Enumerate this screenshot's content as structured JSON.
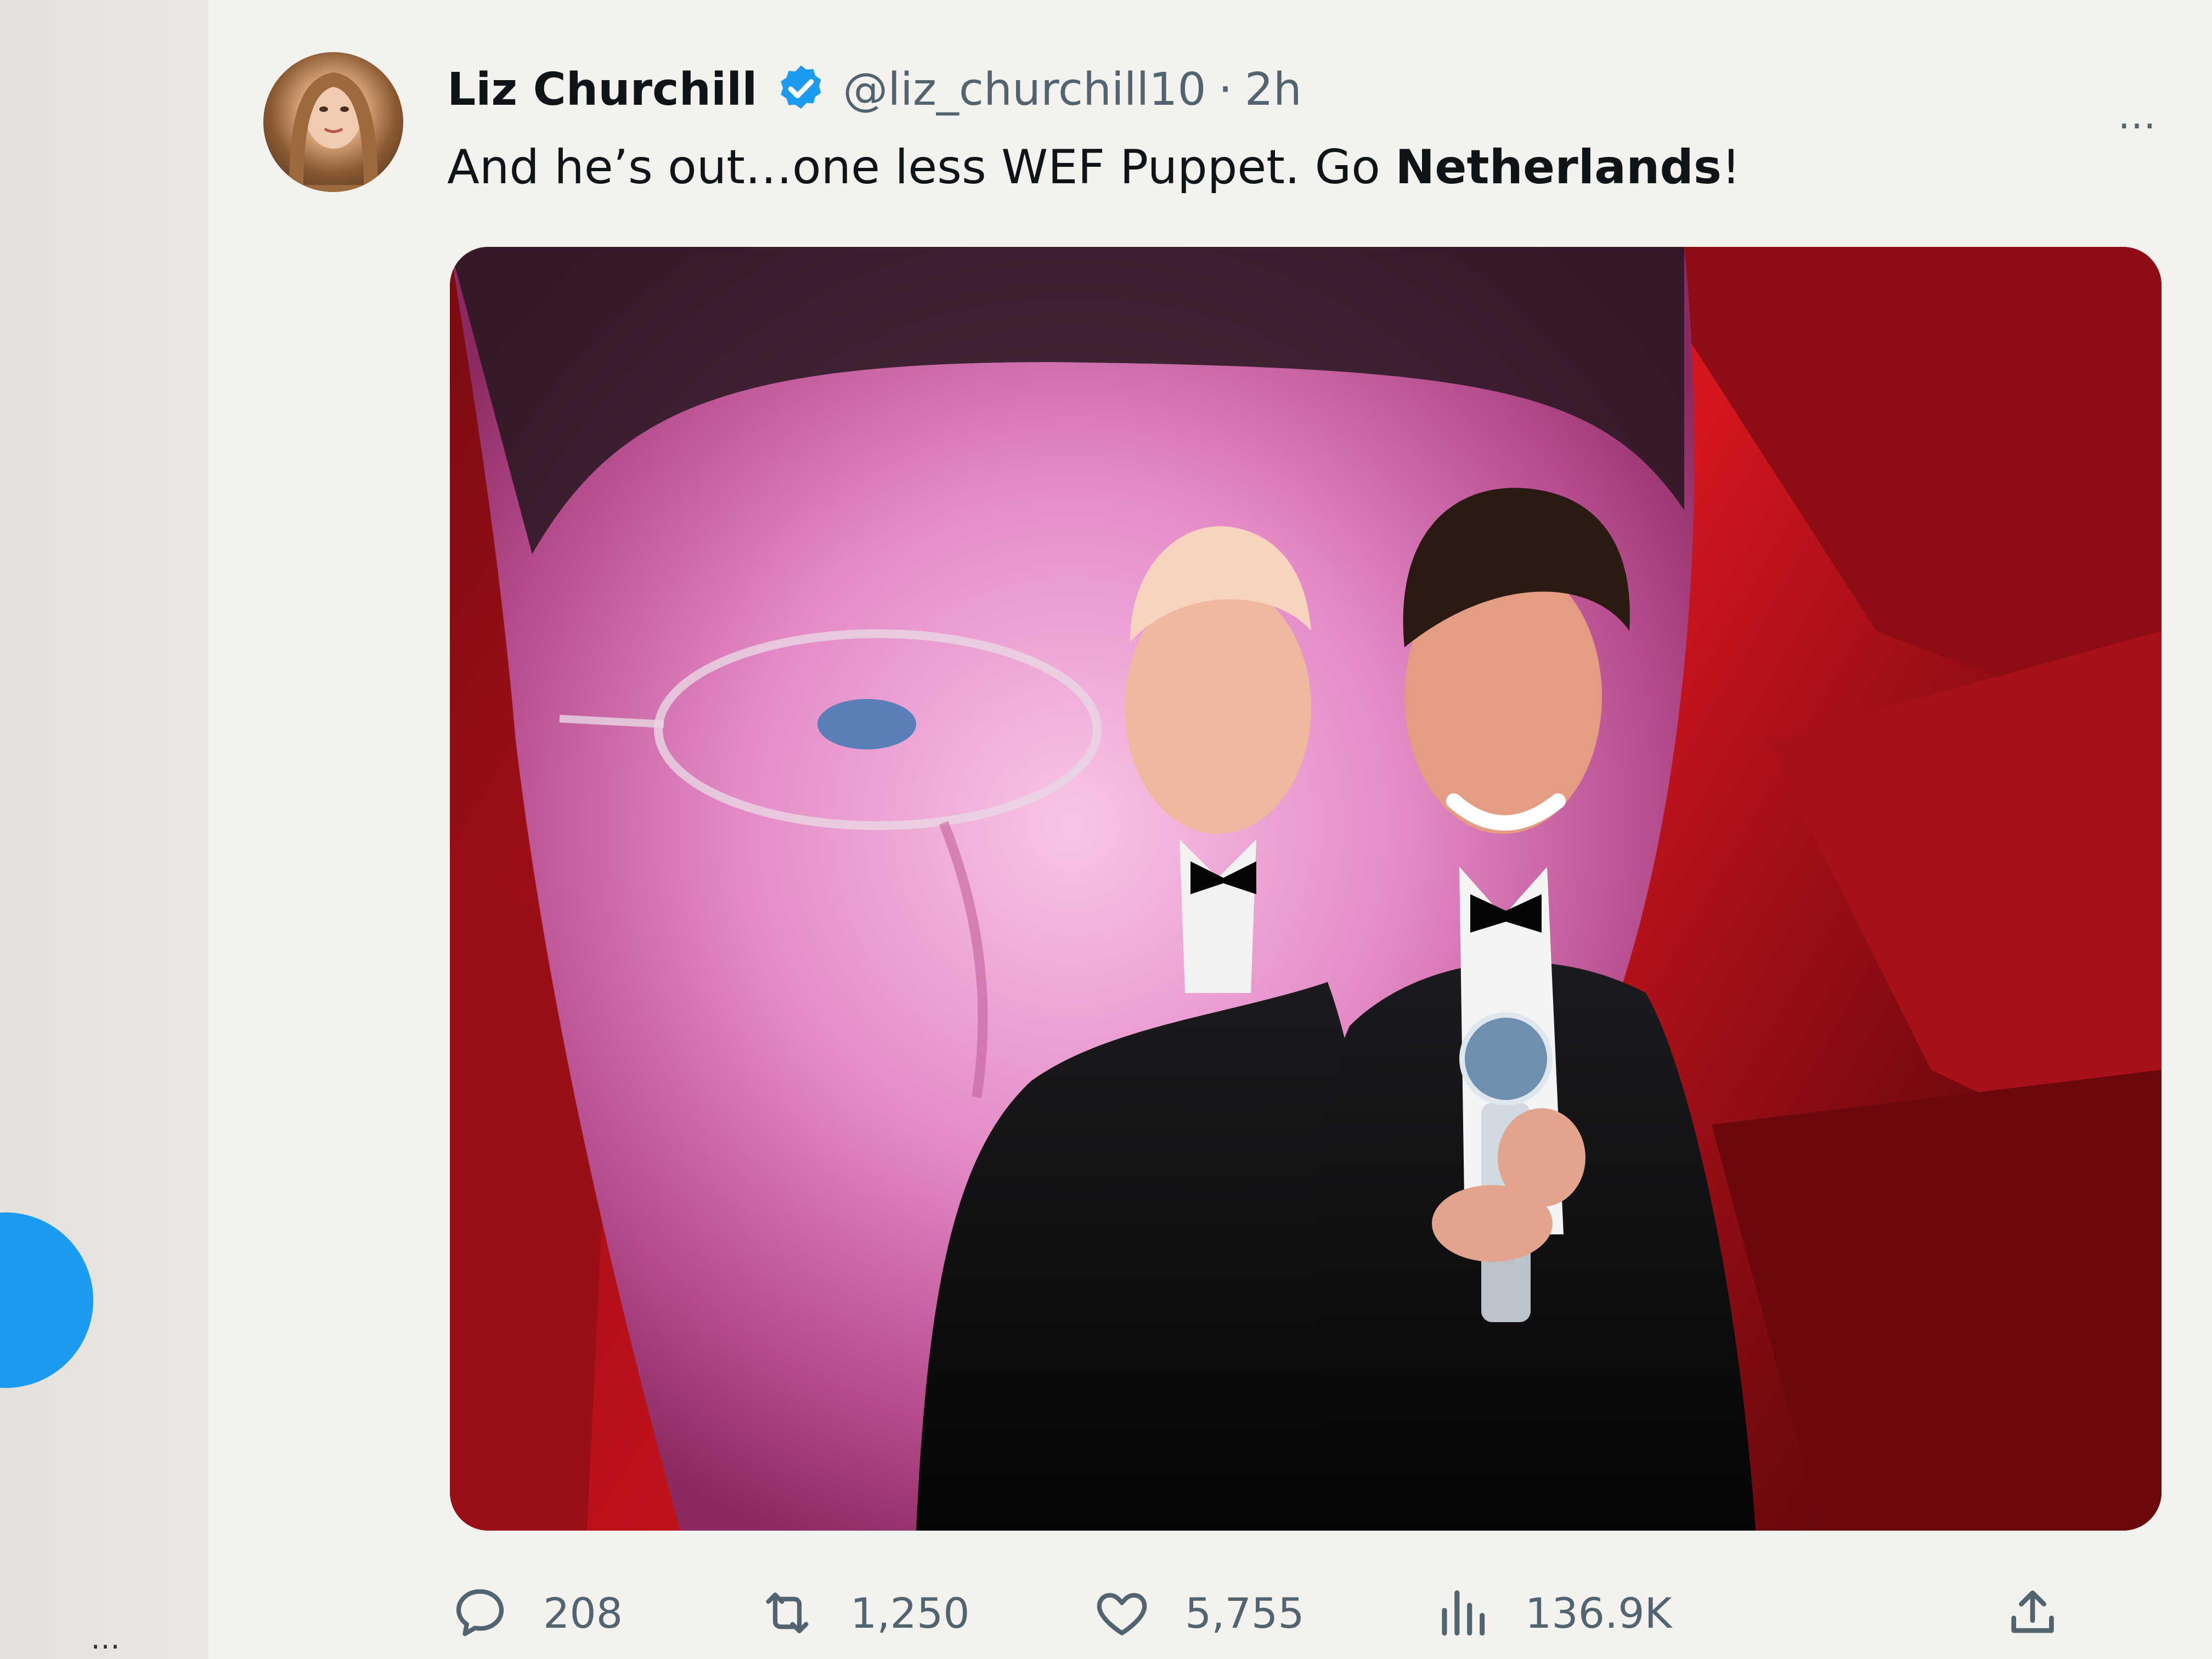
{
  "tweet": {
    "author_name": "Liz Churchill",
    "handle": "@liz_churchill10",
    "separator": "·",
    "time": "2h",
    "text_before": "And he’s out…one less WEF Puppet. Go ",
    "text_bold": "Netherlands",
    "text_after": "!",
    "more_label": "…",
    "media_alt": "Photo of two men in tuxedos on a stage holding a glass award, with a large red-toned face projected behind them"
  },
  "actions": {
    "replies": "208",
    "retweets": "1,250",
    "likes": "5,755",
    "views": "136.9K"
  },
  "sidebar": {
    "more_label": "…"
  },
  "colors": {
    "accent": "#1d9bf0",
    "text_primary": "#0f1419",
    "text_secondary": "#536471",
    "media_red": "#c4131c"
  },
  "icons": [
    "verified-badge-icon",
    "more-icon",
    "reply-icon",
    "retweet-icon",
    "like-icon",
    "views-icon",
    "share-icon"
  ]
}
